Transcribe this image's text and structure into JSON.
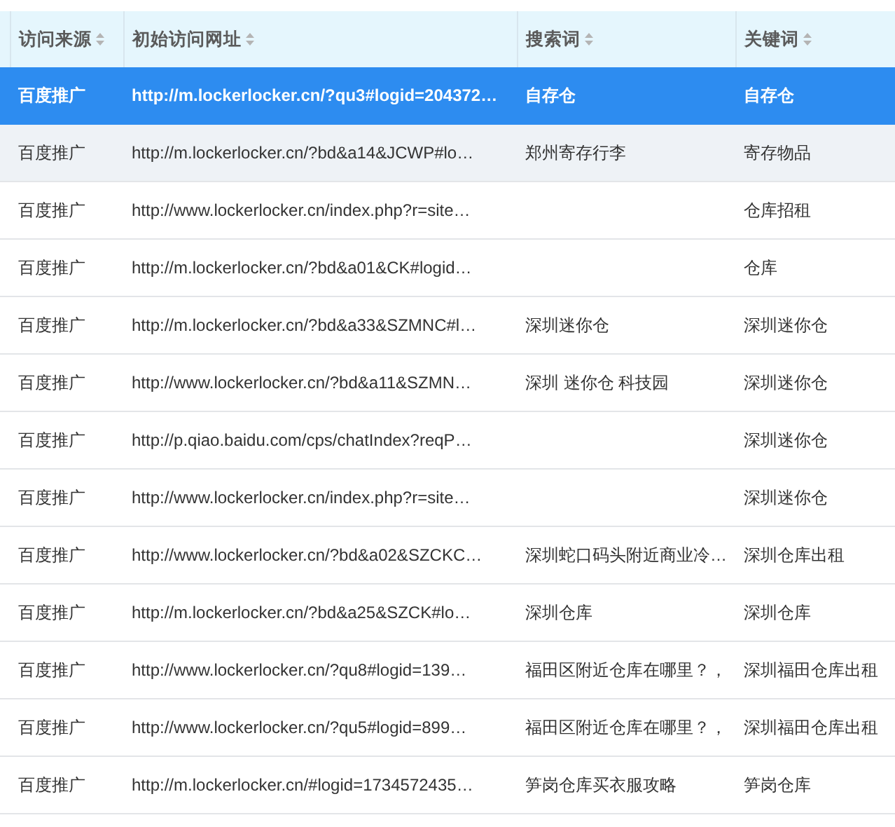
{
  "table": {
    "columns": [
      {
        "label": "访问来源"
      },
      {
        "label": "初始访问网址"
      },
      {
        "label": "搜索词"
      },
      {
        "label": "关键词"
      }
    ],
    "rows": [
      {
        "source": "百度推广",
        "url": "http://m.lockerlocker.cn/?qu3#logid=204372…",
        "search": "自存仓",
        "keyword": "自存仓",
        "selected": true,
        "hovered": false
      },
      {
        "source": "百度推广",
        "url": "http://m.lockerlocker.cn/?bd&a14&JCWP#lo…",
        "search": "郑州寄存行李",
        "keyword": "寄存物品",
        "selected": false,
        "hovered": true
      },
      {
        "source": "百度推广",
        "url": "http://www.lockerlocker.cn/index.php?r=site…",
        "search": "",
        "keyword": "仓库招租",
        "selected": false,
        "hovered": false
      },
      {
        "source": "百度推广",
        "url": "http://m.lockerlocker.cn/?bd&a01&CK#logid…",
        "search": "",
        "keyword": "仓库",
        "selected": false,
        "hovered": false
      },
      {
        "source": "百度推广",
        "url": "http://m.lockerlocker.cn/?bd&a33&SZMNC#l…",
        "search": "深圳迷你仓",
        "keyword": "深圳迷你仓",
        "selected": false,
        "hovered": false
      },
      {
        "source": "百度推广",
        "url": "http://www.lockerlocker.cn/?bd&a11&SZMN…",
        "search": "深圳 迷你仓 科技园",
        "keyword": "深圳迷你仓",
        "selected": false,
        "hovered": false
      },
      {
        "source": "百度推广",
        "url": "http://p.qiao.baidu.com/cps/chatIndex?reqP…",
        "search": "",
        "keyword": "深圳迷你仓",
        "selected": false,
        "hovered": false
      },
      {
        "source": "百度推广",
        "url": "http://www.lockerlocker.cn/index.php?r=site…",
        "search": "",
        "keyword": "深圳迷你仓",
        "selected": false,
        "hovered": false
      },
      {
        "source": "百度推广",
        "url": "http://www.lockerlocker.cn/?bd&a02&SZCKC…",
        "search": "深圳蛇口码头附近商业冷…",
        "keyword": "深圳仓库出租",
        "selected": false,
        "hovered": false
      },
      {
        "source": "百度推广",
        "url": "http://m.lockerlocker.cn/?bd&a25&SZCK#lo…",
        "search": "深圳仓库",
        "keyword": "深圳仓库",
        "selected": false,
        "hovered": false
      },
      {
        "source": "百度推广",
        "url": "http://www.lockerlocker.cn/?qu8#logid=139…",
        "search": "福田区附近仓库在哪里？，",
        "keyword": "深圳福田仓库出租",
        "selected": false,
        "hovered": false
      },
      {
        "source": "百度推广",
        "url": "http://www.lockerlocker.cn/?qu5#logid=899…",
        "search": "福田区附近仓库在哪里？，",
        "keyword": "深圳福田仓库出租",
        "selected": false,
        "hovered": false
      },
      {
        "source": "百度推广",
        "url": "http://m.lockerlocker.cn/#logid=1734572435…",
        "search": "笋岗仓库买衣服攻略",
        "keyword": "笋岗仓库",
        "selected": false,
        "hovered": false
      }
    ]
  }
}
